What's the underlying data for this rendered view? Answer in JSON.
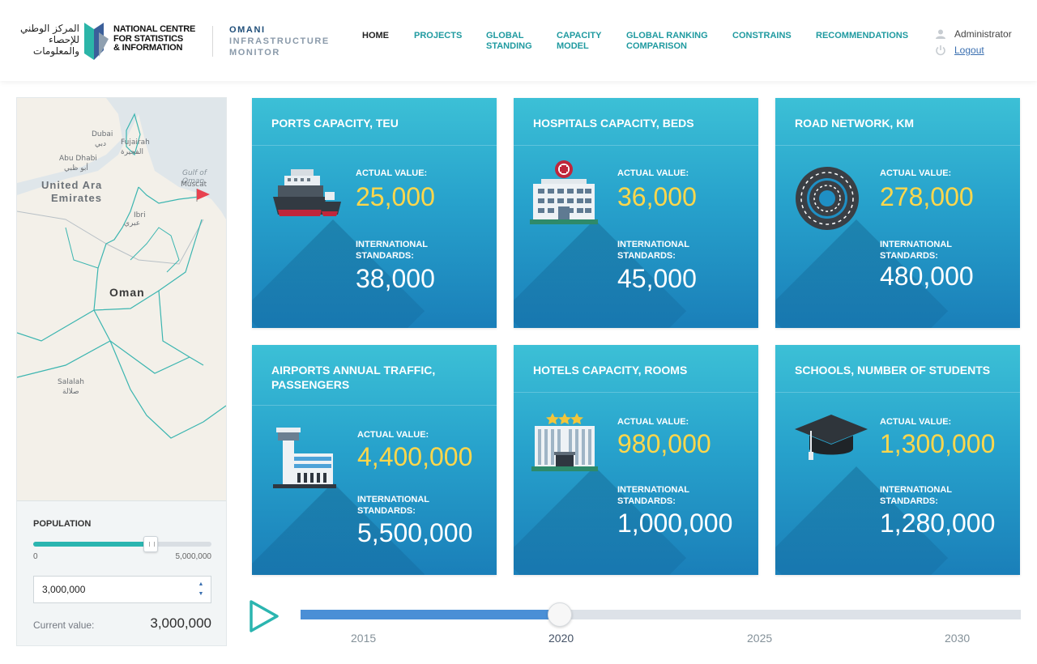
{
  "header": {
    "logo_ar": "المركز الوطني للإحصاء والمعلومات",
    "logo_en": [
      "NATIONAL CENTRE",
      "FOR STATISTICS",
      "& INFORMATION"
    ],
    "app_title": [
      "OMANI",
      "INFRASTRUCTURE",
      "MONITOR"
    ],
    "nav": [
      {
        "label": "HOME",
        "active": true
      },
      {
        "label": "PROJECTS"
      },
      {
        "label": "GLOBAL STANDING"
      },
      {
        "label": "CAPACITY MODEL"
      },
      {
        "label": "GLOBAL RANKING COMPARISON"
      },
      {
        "label": "CONSTRAINS"
      },
      {
        "label": "RECOMMENDATIONS"
      }
    ],
    "user_name": "Administrator",
    "logout_label": "Logout"
  },
  "map": {
    "labels": {
      "dubai": "Dubai",
      "dubai_ar": "دبي",
      "fujairah": "Fujairah",
      "fujairah_ar": "الفجيرة",
      "abu_dhabi": "Abu Dhabi",
      "abu_dhabi_ar": "أبو ظبي",
      "uae_line1": "United Ara",
      "uae_line2": "Emirates",
      "gulf": "Gulf of Oman",
      "muscat": "Muscat",
      "ibri": "Ibri",
      "ibri_ar": "عبري",
      "oman": "Oman",
      "salalah": "Salalah",
      "salalah_ar": "صلالة"
    }
  },
  "population": {
    "label": "POPULATION",
    "min_label": "0",
    "max_label": "5,000,000",
    "fraction": 0.66,
    "input_value": "3,000,000",
    "current_label": "Current value:",
    "current_value": "3,000,000"
  },
  "cards": [
    {
      "title": "PORTS CAPACITY, TEU",
      "actual_label": "ACTUAL VALUE:",
      "actual": "25,000",
      "std_label": "INTERNATIONAL STANDARDS:",
      "std": "38,000",
      "icon": "ship-icon"
    },
    {
      "title": "HOSPITALS CAPACITY, BEDS",
      "actual_label": "ACTUAL VALUE:",
      "actual": "36,000",
      "std_label": "INTERNATIONAL STANDARDS:",
      "std": "45,000",
      "icon": "hospital-icon"
    },
    {
      "title": "ROAD NETWORK, KM",
      "actual_label": "ACTUAL VALUE:",
      "actual": "278,000",
      "std_label": "INTERNATIONAL STANDARDS:",
      "std": "480,000",
      "icon": "road-icon"
    },
    {
      "title": "AIRPORTS ANNUAL TRAFFIC, PASSENGERS",
      "actual_label": "ACTUAL VALUE:",
      "actual": "4,400,000",
      "std_label": "INTERNATIONAL STANDARDS:",
      "std": "5,500,000",
      "icon": "airport-icon"
    },
    {
      "title": "HOTELS CAPACITY, ROOMS",
      "actual_label": "ACTUAL VALUE:",
      "actual": "980,000",
      "std_label": "INTERNATIONAL STANDARDS:",
      "std": "1,000,000",
      "icon": "hotel-icon"
    },
    {
      "title": "SCHOOLS, NUMBER OF STUDENTS",
      "actual_label": "ACTUAL VALUE:",
      "actual": "1,300,000",
      "std_label": "INTERNATIONAL STANDARDS:",
      "std": "1,280,000",
      "icon": "graduation-cap-icon"
    }
  ],
  "timeline": {
    "years": [
      "2015",
      "2020",
      "2025",
      "2030"
    ],
    "current_year": "2020",
    "progress": 0.36
  },
  "colors": {
    "accent_teal": "#1f9aa0",
    "actual_value": "#FFD74B",
    "std_value": "#FFFFFF",
    "timeline_fill": "#4a8fd6"
  }
}
